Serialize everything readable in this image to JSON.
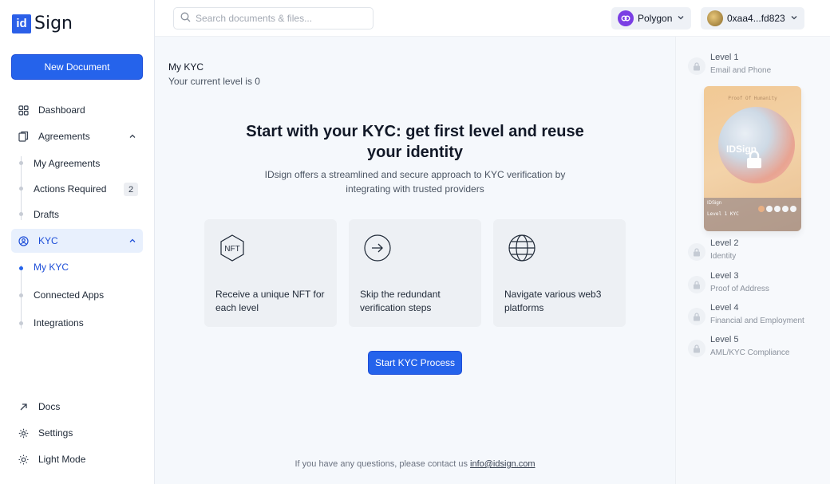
{
  "brand": {
    "logo_mark": "id",
    "logo_text": "Sign"
  },
  "sidebar": {
    "new_document": "New Document",
    "items": [
      {
        "label": "Dashboard",
        "icon": "grid-icon"
      },
      {
        "label": "Agreements",
        "icon": "copy-icon"
      },
      {
        "label": "KYC",
        "icon": "user-circle-icon"
      }
    ],
    "agreements_sub": [
      {
        "label": "My Agreements"
      },
      {
        "label": "Actions Required",
        "badge": "2"
      },
      {
        "label": "Drafts"
      }
    ],
    "kyc_sub": [
      {
        "label": "My KYC"
      },
      {
        "label": "Connected Apps"
      },
      {
        "label": "Integrations"
      }
    ],
    "bottom": [
      {
        "label": "Docs",
        "icon": "arrow-up-right-icon"
      },
      {
        "label": "Settings",
        "icon": "gear-icon"
      },
      {
        "label": "Light Mode",
        "icon": "sun-icon"
      }
    ]
  },
  "header": {
    "search_placeholder": "Search documents & files...",
    "network": "Polygon",
    "wallet": "0xaa4...fd823"
  },
  "main": {
    "title": "My KYC",
    "current_level": "Your current level is 0",
    "hero_title": "Start with your KYC: get first level and reuse your identity",
    "hero_subtitle": "IDsign offers a streamlined and secure approach to KYC verification by integrating with trusted providers",
    "cards": [
      {
        "text": "Receive a unique NFT for each level",
        "icon": "nft-icon"
      },
      {
        "text": "Skip the redundant verification steps",
        "icon": "arrow-right-circle-icon"
      },
      {
        "text": "Navigate various web3 platforms",
        "icon": "globe-icon"
      }
    ],
    "start_button": "Start KYC Process",
    "footer_text": "If you have any questions, please contact us",
    "footer_email": "info@idsign.com"
  },
  "levels": [
    {
      "name": "Level 1",
      "desc": "Email and Phone"
    },
    {
      "name": "Level 2",
      "desc": "Identity"
    },
    {
      "name": "Level 3",
      "desc": "Proof of Address"
    },
    {
      "name": "Level 4",
      "desc": "Financial and Employment"
    },
    {
      "name": "Level 5",
      "desc": "AML/KYC Compliance"
    }
  ],
  "nft_card": {
    "top_text": "Proof Of Humanity",
    "logo": "IDSign",
    "bottom_brand": "IDSign",
    "bottom_level": "Level 1 KYC"
  },
  "colors": {
    "accent": "#2563eb",
    "network": "#7b3fe4",
    "background": "#f5f8fc"
  }
}
